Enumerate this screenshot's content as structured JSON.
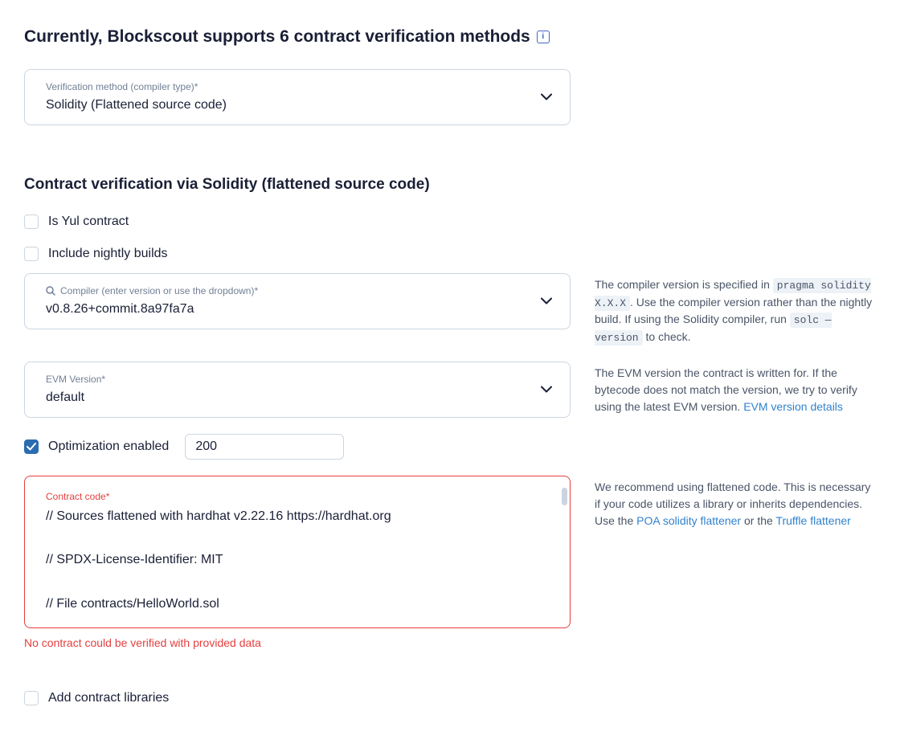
{
  "heading": "Currently, Blockscout supports 6 contract verification methods",
  "verification_method": {
    "label": "Verification method (compiler type)*",
    "value": "Solidity (Flattened source code)"
  },
  "section_title": "Contract verification via Solidity (flattened source code)",
  "is_yul": {
    "label": "Is Yul contract",
    "checked": false
  },
  "nightly": {
    "label": "Include nightly builds",
    "checked": false
  },
  "compiler": {
    "label": "Compiler (enter version or use the dropdown)*",
    "value": "v0.8.26+commit.8a97fa7a"
  },
  "compiler_help": {
    "pre": "The compiler version is specified in ",
    "code1": "pragma solidity X.X.X",
    "mid": ". Use the compiler version rather than the nightly build. If using the Solidity compiler, run ",
    "code2": "solc —version",
    "post": " to check."
  },
  "evm": {
    "label": "EVM Version*",
    "value": "default"
  },
  "evm_help": {
    "text": "The EVM version the contract is written for. If the bytecode does not match the version, we try to verify using the latest EVM version. ",
    "link": "EVM version details"
  },
  "optimization": {
    "label": "Optimization enabled",
    "checked": true,
    "runs": "200"
  },
  "code": {
    "label": "Contract code*",
    "value": "// Sources flattened with hardhat v2.22.16 https://hardhat.org\n\n// SPDX-License-Identifier: MIT\n\n// File contracts/HelloWorld.sol",
    "error": "No contract could be verified with provided data"
  },
  "code_help": {
    "pre": "We recommend using flattened code. This is necessary if your code utilizes a library or inherits dependencies. Use the ",
    "link1": "POA solidity flattener",
    "mid": " or the ",
    "link2": "Truffle flattener"
  },
  "libraries": {
    "label": "Add contract libraries",
    "checked": false
  }
}
